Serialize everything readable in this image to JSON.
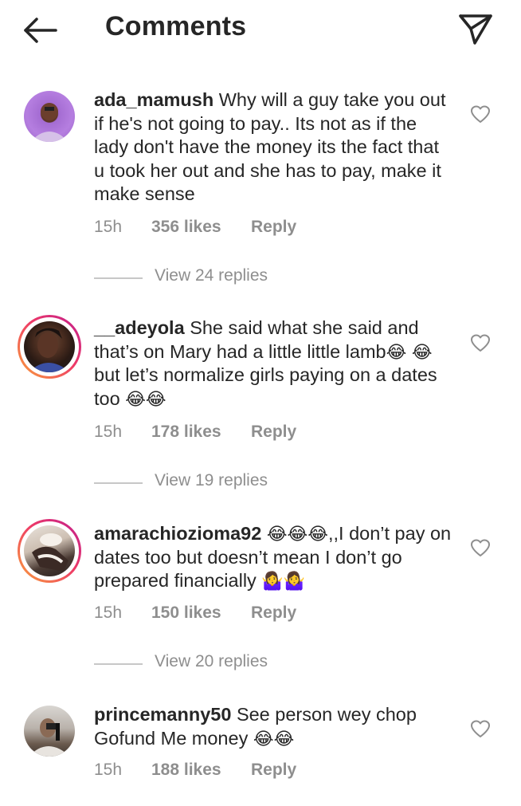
{
  "header": {
    "title": "Comments",
    "back_icon": "arrow-left-icon",
    "send_icon": "send-paper-plane-icon"
  },
  "comments": [
    {
      "username": "ada_mamush",
      "text": "Why will a guy take you out if he's not going to pay.. Its not as if the lady don't have the money its the fact that u took her out and she has to pay, make it make sense",
      "time": "15h",
      "likes": "356 likes",
      "reply": "Reply",
      "view_replies": "View 24 replies",
      "has_story_ring": false
    },
    {
      "username": "__adeyola",
      "text_parts": [
        "She said what she said and that’s on Mary had a little little lamb",
        "😂",
        " ",
        "😂",
        " but let’s normalize girls paying on a dates too ",
        "😂😂"
      ],
      "time": "15h",
      "likes": "178 likes",
      "reply": "Reply",
      "view_replies": "View 19 replies",
      "has_story_ring": true
    },
    {
      "username": "amarachiozioma92",
      "text_parts": [
        "😂😂😂",
        ",,I don’t pay on dates too but doesn’t mean I don’t go prepared financially ",
        "🤷‍♀️🤷‍♀️"
      ],
      "time": "15h",
      "likes": "150 likes",
      "reply": "Reply",
      "view_replies": "View 20 replies",
      "has_story_ring": true
    },
    {
      "username": "princemanny50",
      "text_parts": [
        "See person wey chop Gofund Me money ",
        "😂😂"
      ],
      "time": "15h",
      "likes": "188 likes",
      "reply": "Reply",
      "has_story_ring": false
    }
  ],
  "colors": {
    "text": "#262626",
    "secondary": "#8e8e8e",
    "ring_start": "#f9a13a",
    "ring_end": "#c01e8e"
  }
}
